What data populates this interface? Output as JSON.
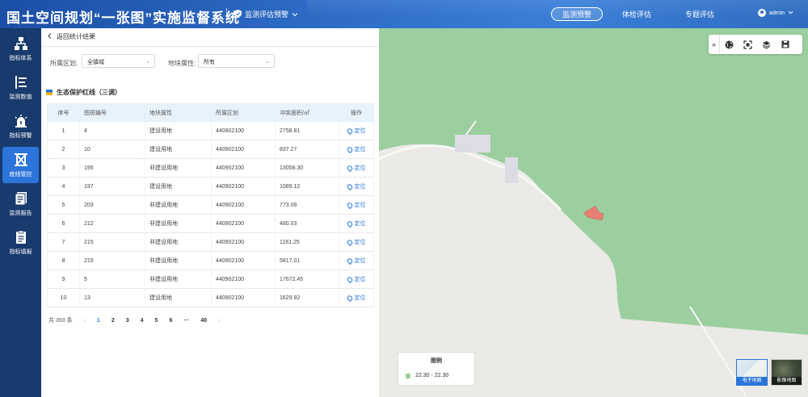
{
  "header": {
    "title": "国土空间规划“一张图”实施监督系统",
    "system_switch": "监测评估预警",
    "nav": [
      "监测预警",
      "体检评估",
      "专题评估"
    ],
    "user": "admin"
  },
  "sidebar": {
    "items": [
      {
        "label": "指标体系",
        "icon": "hierarchy-icon"
      },
      {
        "label": "监测数值",
        "icon": "data-list-icon"
      },
      {
        "label": "指标预警",
        "icon": "alarm-icon"
      },
      {
        "label": "底线管控",
        "icon": "boundary-control-icon"
      },
      {
        "label": "监测报告",
        "icon": "report-icon"
      },
      {
        "label": "指标填报",
        "icon": "fill-form-icon"
      }
    ],
    "active_index": 3
  },
  "panel": {
    "back_label": "返回统计结果",
    "filters": {
      "region_label": "所属区划:",
      "region_value": "全镇域",
      "attr_label": "地块属性:",
      "attr_value": "所有"
    },
    "section_title": "生态保护红线（三调）",
    "table": {
      "columns": [
        "序号",
        "图斑编号",
        "地块属性",
        "所属区划",
        "冲突面积/㎡",
        "操作"
      ],
      "rows": [
        [
          "1",
          "4",
          "建设用地",
          "440902100",
          "2758.81",
          "定位"
        ],
        [
          "2",
          "10",
          "建设用地",
          "440902100",
          "837.27",
          "定位"
        ],
        [
          "3",
          "195",
          "非建设用地",
          "440902100",
          "13058.30",
          "定位"
        ],
        [
          "4",
          "197",
          "建设用地",
          "440902100",
          "1089.12",
          "定位"
        ],
        [
          "5",
          "203",
          "非建设用地",
          "440902100",
          "773.09",
          "定位"
        ],
        [
          "6",
          "212",
          "非建设用地",
          "440902100",
          "480.03",
          "定位"
        ],
        [
          "7",
          "215",
          "非建设用地",
          "440902100",
          "1161.25",
          "定位"
        ],
        [
          "8",
          "219",
          "非建设用地",
          "440902100",
          "5817.01",
          "定位"
        ],
        [
          "9",
          "5",
          "非建设用地",
          "440902100",
          "17672.45",
          "定位"
        ],
        [
          "10",
          "13",
          "建设用地",
          "440902100",
          "1629.92",
          "定位"
        ]
      ]
    },
    "pager": {
      "total": "共 393 条",
      "prev": "‹",
      "pages": [
        "1",
        "2",
        "3",
        "4",
        "5",
        "6",
        "···",
        "40"
      ],
      "current": "1",
      "next": "›"
    }
  },
  "map": {
    "toolbar": [
      "»",
      "globe-icon",
      "fullscreen-icon",
      "layers-icon",
      "save-icon"
    ],
    "legend_title": "图例",
    "legend_item": "22.30 - 22.30",
    "legend_color": "#9ccf9f",
    "basemaps": [
      "电子地图",
      "影像地图"
    ],
    "colors": {
      "land": "#ebeae6",
      "eco": "#9ccf9f",
      "conflict": "#e57f74",
      "accent": "#2b74d9"
    }
  }
}
